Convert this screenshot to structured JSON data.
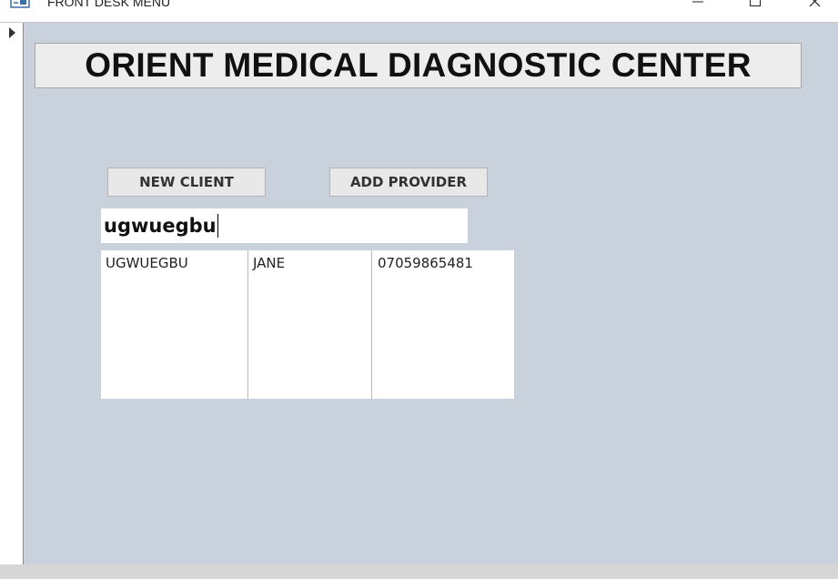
{
  "window": {
    "title": "FRONT DESK MENU"
  },
  "header": {
    "title": "ORIENT MEDICAL DIAGNOSTIC CENTER"
  },
  "buttons": {
    "new_client": "NEW CLIENT",
    "add_provider": "ADD PROVIDER"
  },
  "search": {
    "value": "ugwuegbu"
  },
  "results": [
    {
      "surname": "UGWUEGBU",
      "firstname": "JANE",
      "phone": "07059865481"
    }
  ],
  "icons": {
    "app": "form-icon",
    "record_selector": "record-selector-arrow-icon",
    "minimize": "minimize-icon",
    "maximize": "maximize-icon",
    "close": "close-icon"
  },
  "colors": {
    "form_background": "#c9d1dd",
    "header_background": "#ededed",
    "button_background": "#e8e8e8"
  }
}
